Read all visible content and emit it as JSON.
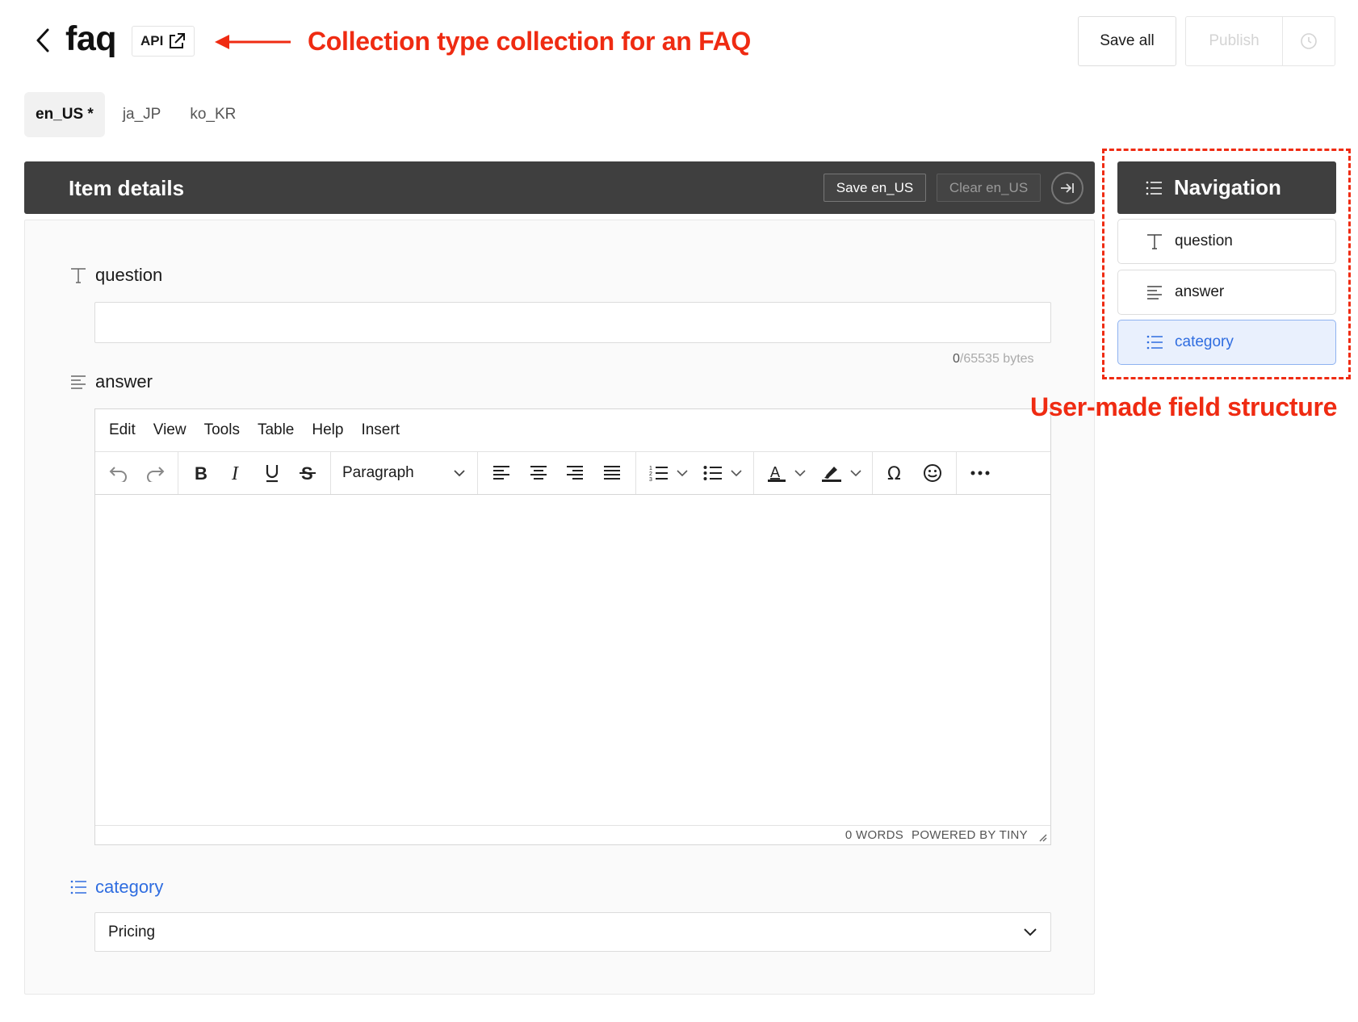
{
  "header": {
    "title": "faq",
    "api_label": "API",
    "save_all_label": "Save all",
    "publish_label": "Publish"
  },
  "annotations": {
    "title_note": "Collection type collection for an FAQ",
    "nav_note": "User-made field structure"
  },
  "locales": [
    {
      "label": "en_US *",
      "active": true
    },
    {
      "label": "ja_JP",
      "active": false
    },
    {
      "label": "ko_KR",
      "active": false
    }
  ],
  "item_details": {
    "title": "Item details",
    "save_label": "Save en_US",
    "clear_label": "Clear en_US"
  },
  "fields": {
    "question": {
      "label": "question",
      "value": "",
      "bytes_used": "0",
      "bytes_max": "/65535 bytes"
    },
    "answer": {
      "label": "answer",
      "menu": [
        "Edit",
        "View",
        "Tools",
        "Table",
        "Help",
        "Insert"
      ],
      "block_format": "Paragraph",
      "word_count": "0 WORDS",
      "powered_by": "POWERED BY TINY"
    },
    "category": {
      "label": "category",
      "value": "Pricing"
    }
  },
  "navigation": {
    "title": "Navigation",
    "items": [
      {
        "label": "question",
        "icon": "text-icon",
        "active": false
      },
      {
        "label": "answer",
        "icon": "textarea-icon",
        "active": false
      },
      {
        "label": "category",
        "icon": "list-icon",
        "active": true
      }
    ]
  },
  "colors": {
    "accent": "#2f6de0",
    "annotation": "#ef2b12",
    "bar": "#3f3f3f"
  }
}
